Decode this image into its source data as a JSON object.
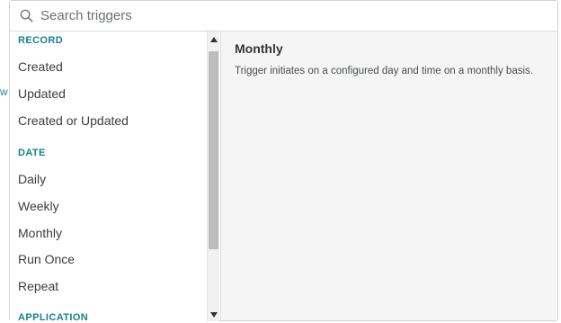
{
  "background": {
    "fragment": "w"
  },
  "search": {
    "placeholder": "Search triggers",
    "value": ""
  },
  "list": {
    "sections": [
      {
        "header": "RECORD",
        "items": [
          "Created",
          "Updated",
          "Created or Updated"
        ]
      },
      {
        "header": "DATE",
        "items": [
          "Daily",
          "Weekly",
          "Monthly",
          "Run Once",
          "Repeat"
        ]
      },
      {
        "header": "APPLICATION",
        "items": []
      }
    ]
  },
  "detail": {
    "title": "Monthly",
    "description": "Trigger initiates on a configured day and time on a monthly basis."
  },
  "colors": {
    "section_header": "#12838f",
    "detail_background": "#f4f5f4",
    "scroll_thumb": "#bdbdbd"
  },
  "icons": {
    "search": "search-icon",
    "scroll_up": "triangle-up-icon",
    "scroll_down": "triangle-down-icon"
  }
}
